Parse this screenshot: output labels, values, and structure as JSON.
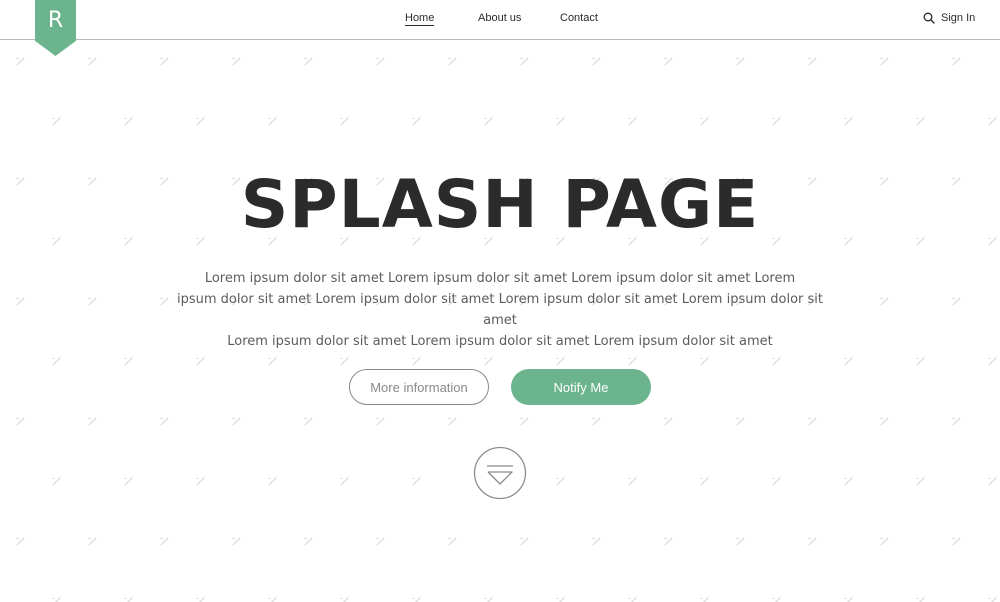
{
  "brand": {
    "logo_letter": "R",
    "accent_color": "#6cb48e"
  },
  "nav": {
    "items": [
      {
        "label": "Home",
        "active": true
      },
      {
        "label": "About us",
        "active": false
      },
      {
        "label": "Contact",
        "active": false
      }
    ],
    "search_icon": "search-icon",
    "signin_label": "Sign In"
  },
  "hero": {
    "title": "SPLASH PAGE",
    "body_lines": [
      "Lorem ipsum dolor sit amet Lorem ipsum dolor sit amet Lorem ipsum dolor sit amet Lorem",
      "ipsum dolor sit amet Lorem ipsum dolor sit amet Lorem ipsum dolor sit amet Lorem ipsum dolor sit amet",
      "Lorem ipsum dolor sit amet Lorem ipsum dolor sit amet Lorem ipsum dolor sit amet"
    ],
    "buttons": {
      "more_info": "More information",
      "notify": "Notify Me"
    },
    "scroll_icon": "scroll-down-icon"
  }
}
